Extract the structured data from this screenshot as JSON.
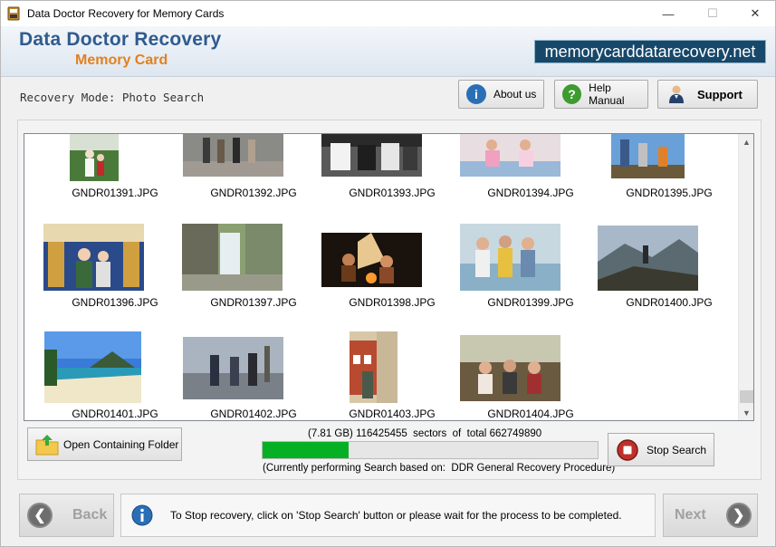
{
  "window": {
    "title": "Data Doctor Recovery for Memory Cards",
    "minimize": "—",
    "maximize": "☐",
    "close": "✕"
  },
  "header": {
    "brand_line1": "Data Doctor Recovery",
    "brand_line2": "Memory Card",
    "website": "memorycarddatarecovery.net"
  },
  "toolbar": {
    "mode_label": "Recovery Mode: Photo Search",
    "about_label": "About us",
    "help_label": "Help Manual",
    "support_label": "Support"
  },
  "gallery": {
    "items": [
      {
        "name": "GNDR01391.JPG",
        "icon": "photo-thumbnail"
      },
      {
        "name": "GNDR01392.JPG",
        "icon": "photo-thumbnail"
      },
      {
        "name": "GNDR01393.JPG",
        "icon": "photo-thumbnail"
      },
      {
        "name": "GNDR01394.JPG",
        "icon": "photo-thumbnail"
      },
      {
        "name": "GNDR01395.JPG",
        "icon": "photo-thumbnail"
      },
      {
        "name": "GNDR01396.JPG",
        "icon": "photo-thumbnail"
      },
      {
        "name": "GNDR01397.JPG",
        "icon": "photo-thumbnail"
      },
      {
        "name": "GNDR01398.JPG",
        "icon": "photo-thumbnail"
      },
      {
        "name": "GNDR01399.JPG",
        "icon": "photo-thumbnail"
      },
      {
        "name": "GNDR01400.JPG",
        "icon": "photo-thumbnail"
      },
      {
        "name": "GNDR01401.JPG",
        "icon": "photo-thumbnail"
      },
      {
        "name": "GNDR01402.JPG",
        "icon": "photo-thumbnail"
      },
      {
        "name": "GNDR01403.JPG",
        "icon": "photo-thumbnail"
      },
      {
        "name": "GNDR01404.JPG",
        "icon": "photo-thumbnail"
      }
    ]
  },
  "actions": {
    "open_folder_label": "Open Containing Folder",
    "stop_label": "Stop Search"
  },
  "progress": {
    "size": "(7.81 GB)",
    "sectors_done": "116425455",
    "sectors_label": "sectors",
    "of_total_label": "of",
    "total_label": "total",
    "sectors_total": "662749890",
    "fraction": 0.256,
    "status_prefix": "(Currently performing Search based on:",
    "status_procedure": "DDR General Recovery Procedure)"
  },
  "footer": {
    "back_label": "Back",
    "next_label": "Next",
    "info_text": "To Stop recovery, click on 'Stop Search' button or please wait for the process to be completed."
  },
  "colors": {
    "accent": "#2f5b8f",
    "brand_orange": "#e3801e",
    "progress_green": "#06b025"
  }
}
